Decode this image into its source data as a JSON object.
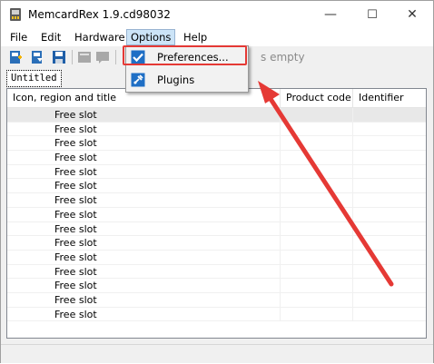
{
  "window": {
    "title": "MemcardRex 1.9.cd98032",
    "minimize_glyph": "—",
    "maximize_glyph": "☐",
    "close_glyph": "✕"
  },
  "menu": {
    "items": [
      "File",
      "Edit",
      "Hardware",
      "Options",
      "Help"
    ]
  },
  "toolbar": {
    "status_text": "s empty"
  },
  "tabs": [
    "Untitled"
  ],
  "columns": {
    "title": "Icon, region and title",
    "product_code": "Product code",
    "identifier": "Identifier"
  },
  "slots": [
    "Free slot",
    "Free slot",
    "Free slot",
    "Free slot",
    "Free slot",
    "Free slot",
    "Free slot",
    "Free slot",
    "Free slot",
    "Free slot",
    "Free slot",
    "Free slot",
    "Free slot",
    "Free slot",
    "Free slot"
  ],
  "options_menu": {
    "items": [
      {
        "label": "Preferences...",
        "icon": "checkbox-icon"
      },
      {
        "label": "Plugins",
        "icon": "plugin-icon"
      }
    ]
  },
  "annotation": {
    "color": "#e53935"
  }
}
